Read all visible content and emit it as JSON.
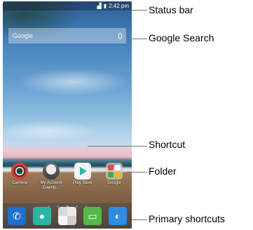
{
  "status_bar": {
    "time": "2:42 pm"
  },
  "search_widget": {
    "brand": "Google"
  },
  "apps": [
    {
      "label": "Camera",
      "icon": "camera-icon"
    },
    {
      "label": "My Account Downlo...",
      "icon": "account-download-icon"
    },
    {
      "label": "Play Store",
      "icon": "play-store-icon"
    },
    {
      "label": "Google",
      "icon": "folder-icon"
    }
  ],
  "dock": [
    {
      "icon": "phone-icon"
    },
    {
      "icon": "contacts-icon"
    },
    {
      "icon": "apps-grid-icon"
    },
    {
      "icon": "messaging-icon"
    },
    {
      "icon": "browser-icon"
    }
  ],
  "callouts": {
    "status_bar": "Status bar",
    "google_search": "Google Search",
    "shortcut": "Shortcut",
    "folder": "Folder",
    "primary_shortcuts": "Primary shortcuts"
  }
}
